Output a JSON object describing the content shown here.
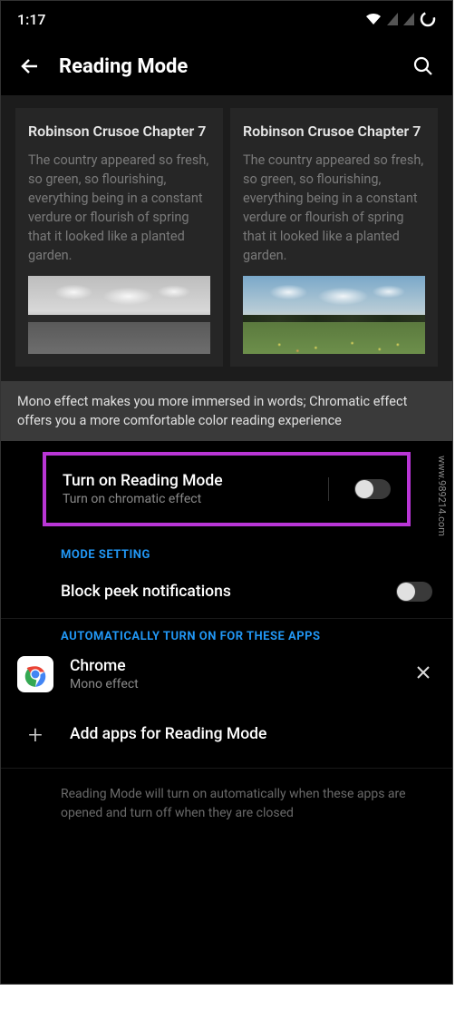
{
  "statusbar": {
    "time": "1:17"
  },
  "toolbar": {
    "title": "Reading Mode"
  },
  "preview": {
    "mono": {
      "title": "Robinson Crusoe Chapter 7",
      "body": "The country appeared so fresh, so green, so flourishing, everything being in a constant verdure or flourish of spring that it looked like a planted garden."
    },
    "chromatic": {
      "title": "Robinson Crusoe Chapter 7",
      "body": "The country appeared so fresh, so green, so flourishing, everything being in a constant verdure or flourish of spring that it looked like a planted garden."
    }
  },
  "description": "Mono effect makes you more immersed in words; Chromatic effect offers you a more comfortable color reading experience",
  "reading_mode_toggle": {
    "title": "Turn on Reading Mode",
    "subtitle": "Turn on chromatic effect",
    "value": false
  },
  "sections": {
    "mode_setting": "MODE SETTING",
    "auto_apps": "AUTOMATICALLY TURN ON FOR THESE APPS"
  },
  "block_peek": {
    "title": "Block peek notifications",
    "value": false
  },
  "apps": [
    {
      "name": "Chrome",
      "effect": "Mono effect",
      "icon": "chrome"
    }
  ],
  "add_apps": {
    "label": "Add apps for Reading Mode"
  },
  "footer": "Reading Mode will turn on automatically when these apps are opened and turn off when they are closed",
  "watermark": "www.989214.com"
}
